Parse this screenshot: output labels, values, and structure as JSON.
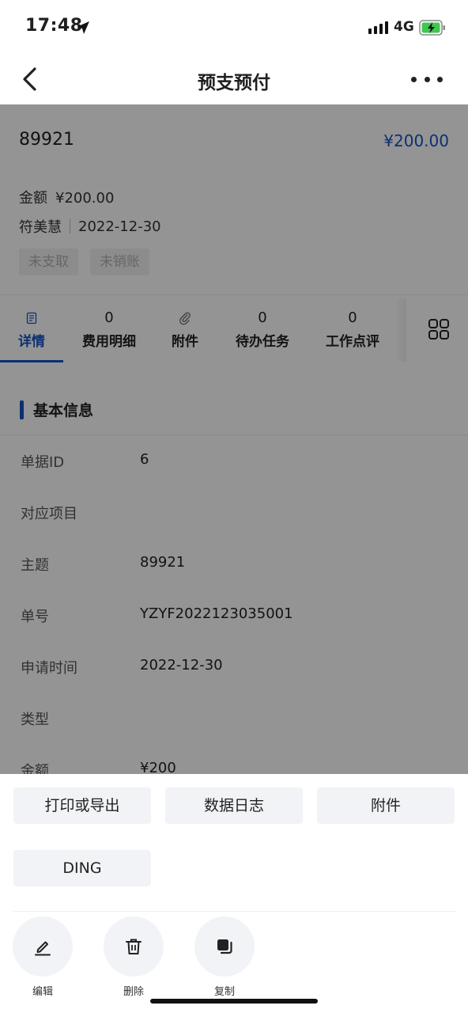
{
  "status_bar": {
    "time": "17:48",
    "network": "4G"
  },
  "nav": {
    "title": "预支预付"
  },
  "summary": {
    "subject": "89921",
    "amount_top": "¥200.00",
    "amount_label": "金额",
    "amount_value": "¥200.00",
    "person": "符美慧",
    "date": "2022-12-30",
    "tags": [
      "未支取",
      "未销账"
    ]
  },
  "tabs": [
    {
      "count": "",
      "label": "详情",
      "active": true
    },
    {
      "count": "0",
      "label": "费用明细"
    },
    {
      "count": "",
      "label": "附件"
    },
    {
      "count": "0",
      "label": "待办任务"
    },
    {
      "count": "0",
      "label": "工作点评"
    }
  ],
  "section": {
    "title": "基本信息"
  },
  "fields": [
    {
      "label": "单据ID",
      "value": "6"
    },
    {
      "label": "对应项目",
      "value": ""
    },
    {
      "label": "主题",
      "value": "89921"
    },
    {
      "label": "单号",
      "value": "YZYF2022123035001"
    },
    {
      "label": "申请时间",
      "value": "2022-12-30"
    },
    {
      "label": "类型",
      "value": ""
    },
    {
      "label": "金额",
      "value": "¥200"
    }
  ],
  "sheet": {
    "actions": [
      "打印或导出",
      "数据日志",
      "附件",
      "DING"
    ],
    "quick_actions": [
      {
        "label": "编辑",
        "icon": "edit-icon"
      },
      {
        "label": "删除",
        "icon": "trash-icon"
      },
      {
        "label": "复制",
        "icon": "copy-icon"
      }
    ]
  },
  "colors": {
    "accent": "#1654c4",
    "overlay": "rgba(0,0,0,0.42)"
  }
}
